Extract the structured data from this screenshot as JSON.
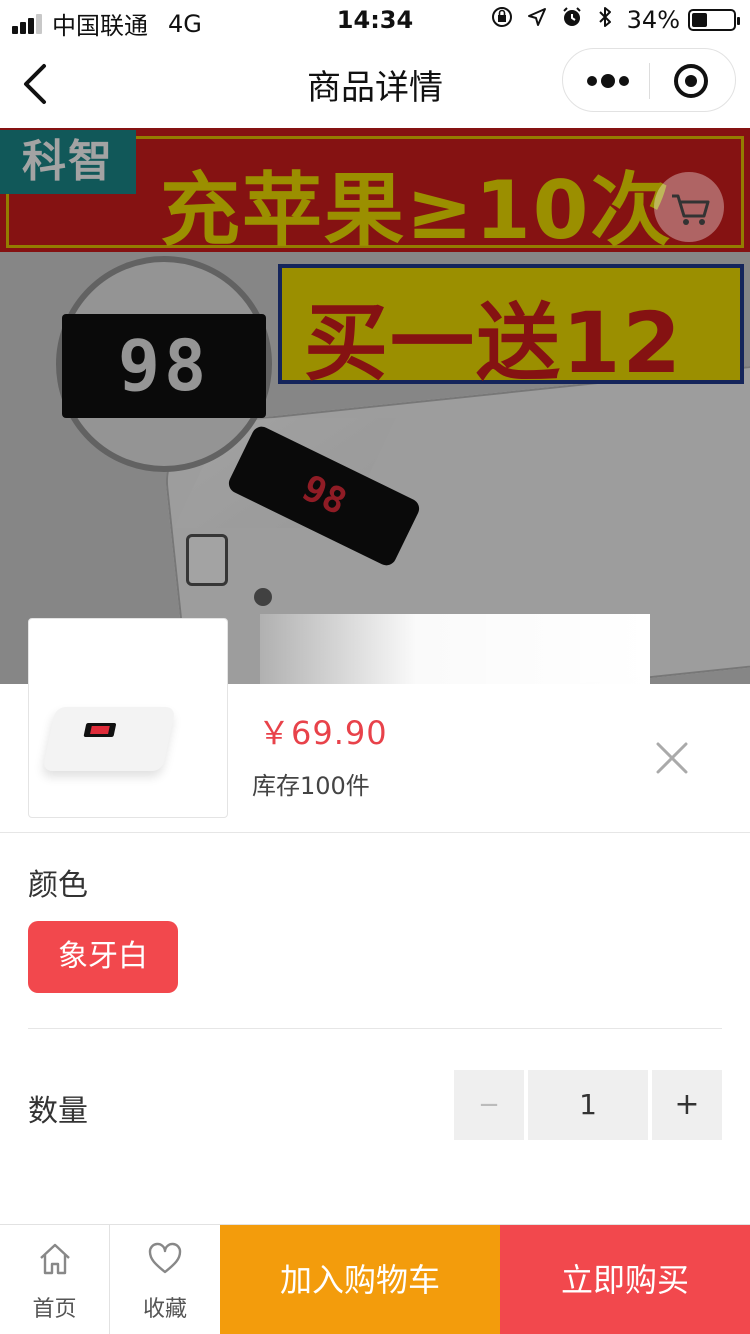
{
  "status_bar": {
    "carrier": "中国联通",
    "network": "4G",
    "time": "14:34",
    "battery_percent": "34%",
    "battery_level": 0.34,
    "icons": [
      "signal-icon",
      "lock-rotation-icon",
      "location-arrow-icon",
      "alarm-icon",
      "bluetooth-icon",
      "battery-icon"
    ]
  },
  "nav": {
    "title": "商品详情",
    "icons": [
      "back-arrow-icon",
      "more-dots-icon",
      "target-circle-icon"
    ]
  },
  "banner": {
    "brand": "科智",
    "headline": "充苹果≥10次",
    "promo": "买一送12",
    "magnifier_display": "98",
    "device_display": "98",
    "cart_icon": "cart-icon"
  },
  "product": {
    "price": "￥69.90",
    "stock": "库存100件"
  },
  "spec": {
    "color_label": "颜色",
    "color_options": [
      "象牙白"
    ],
    "color_selected": "象牙白",
    "quantity_label": "数量",
    "quantity_minus": "−",
    "quantity_value": "1",
    "quantity_plus": "+"
  },
  "bottom_bar": {
    "home_label": "首页",
    "favorite_label": "收藏",
    "add_to_cart": "加入购物车",
    "buy_now": "立即购买"
  },
  "colors": {
    "primary_red": "#f2484d",
    "cart_orange": "#f39c0c",
    "price_red": "#e8424a",
    "stepper_bg": "#efefef"
  }
}
